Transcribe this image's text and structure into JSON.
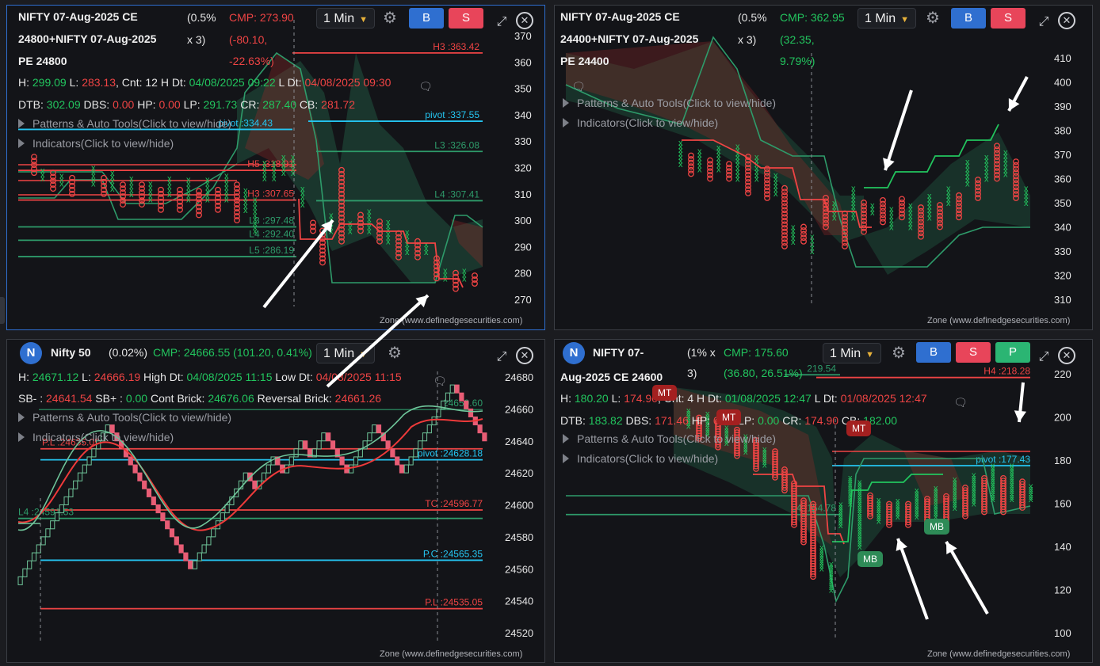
{
  "colors": {
    "green": "#22c55e",
    "red": "#ef4444",
    "cyan": "#25c4f0",
    "teal_line": "#2e9b6a",
    "bg": "#131418"
  },
  "p1": {
    "title_lines": [
      "NIFTY 07-Aug-2025 CE",
      "24800+NIFTY 07-Aug-2025",
      "PE 24800"
    ],
    "pct_lines": [
      "(0.5%",
      "x 3)"
    ],
    "cmp_lines": [
      "CMP: 273.90",
      "(-80.10,",
      "-22.63%)"
    ],
    "interval": "1 Min",
    "buy": "B",
    "sell": "S",
    "row_h": [
      [
        "H: ",
        "w"
      ],
      [
        "299.09",
        "g"
      ],
      [
        " L: ",
        "w"
      ],
      [
        "283.13",
        "r"
      ],
      [
        ", Cnt: 12 H Dt: ",
        "w"
      ],
      [
        "04/08/2025 09:22",
        "g"
      ],
      [
        " L Dt: ",
        "w"
      ],
      [
        "04/08/2025 09:30",
        "r"
      ]
    ],
    "row_d": [
      [
        "DTB: ",
        "w"
      ],
      [
        "302.09",
        "g"
      ],
      [
        " DBS: ",
        "w"
      ],
      [
        "0.00",
        "r"
      ],
      [
        " HP: ",
        "w"
      ],
      [
        "0.00",
        "r"
      ],
      [
        " LP: ",
        "w"
      ],
      [
        "291.73",
        "g"
      ],
      [
        " CR: ",
        "w"
      ],
      [
        "287.40",
        "g"
      ],
      [
        " CB: ",
        "w"
      ],
      [
        "281.72",
        "r"
      ]
    ],
    "patterns": "Patterns & Auto Tools(Click to view/hide)",
    "indicators": "Indicators(Click to view/hide)",
    "axis": [
      "370",
      "360",
      "350",
      "340",
      "330",
      "320",
      "310",
      "300",
      "290",
      "280",
      "270"
    ],
    "levels": [
      {
        "label": "H3 :363.42",
        "color": "#ef4444",
        "value": 363.42
      },
      {
        "label": "pivot :337.55",
        "color": "#25c4f0",
        "value": 337.55
      },
      {
        "label": "pivot :334.43",
        "color": "#25c4f0",
        "value": 334.43
      },
      {
        "label": "L3 :326.08",
        "color": "#2e9b6a",
        "value": 326.08
      },
      {
        "label": "H5 :318.91",
        "color": "#ef4444",
        "value": 318.91
      },
      {
        "label": "H3 :307.65",
        "color": "#ef4444",
        "value": 307.65
      },
      {
        "label": "L4 :307.41",
        "color": "#2e9b6a",
        "value": 307.41
      },
      {
        "label": "L3 :297.48",
        "color": "#2e9b6a",
        "value": 297.48
      },
      {
        "label": "L4 :292.40",
        "color": "#2e9b6a",
        "value": 292.4
      },
      {
        "label": "L5 :286.19",
        "color": "#2e9b6a",
        "value": 286.19
      }
    ],
    "zone": "Zone (www.definedgesecurities.com)"
  },
  "p2": {
    "title_lines": [
      "NIFTY 07-Aug-2025 CE",
      "24400+NIFTY 07-Aug-2025",
      "PE 24400"
    ],
    "pct_lines": [
      "(0.5%",
      "x 3)"
    ],
    "cmp_lines": [
      "CMP: 362.95",
      "(32.35,",
      "9.79%)"
    ],
    "interval": "1 Min",
    "buy": "B",
    "sell": "S",
    "patterns": "Patterns & Auto Tools(Click to view/hide)",
    "indicators": "Indicators(Click to view/hide)",
    "axis": [
      "410",
      "400",
      "390",
      "380",
      "370",
      "360",
      "350",
      "340",
      "330",
      "320",
      "310"
    ],
    "zone": "Zone (www.definedgesecurities.com)"
  },
  "p3": {
    "badge": "N",
    "title": "Nifty 50",
    "pct": "(0.02%)",
    "cmp": "CMP: 24666.55 (101.20, 0.41%)",
    "interval": "1 Min",
    "row_h": [
      [
        "H: ",
        "w"
      ],
      [
        "24671.12",
        "g"
      ],
      [
        " L: ",
        "w"
      ],
      [
        "24666.19",
        "r"
      ],
      [
        " High Dt: ",
        "w"
      ],
      [
        "04/08/2025 11:15",
        "g"
      ],
      [
        " Low Dt: ",
        "w"
      ],
      [
        "04/08/2025 11:15",
        "r"
      ]
    ],
    "row_s": [
      [
        "SB- : ",
        "w"
      ],
      [
        "24641.54",
        "r"
      ],
      [
        " SB+ : ",
        "w"
      ],
      [
        "0.00",
        "g"
      ],
      [
        " Cont Brick: ",
        "w"
      ],
      [
        "24676.06",
        "g"
      ],
      [
        " Reversal Brick: ",
        "w"
      ],
      [
        "24661.26",
        "r"
      ]
    ],
    "patterns": "Patterns & Auto Tools(Click to view/hide)",
    "indicators": "Indicators(Click to view/hide)",
    "axis": [
      "24680",
      "24660",
      "24640",
      "24620",
      "24600",
      "24580",
      "24560",
      "24540",
      "24520"
    ],
    "levels": [
      {
        "label": "24659.60",
        "color": "#2e9b6a",
        "value": 24659.6
      },
      {
        "label": "P.L :24635.05",
        "color": "#ef4444",
        "value": 24635.05
      },
      {
        "label": "pivot :24628.18",
        "color": "#25c4f0",
        "value": 24628.18
      },
      {
        "label": "TC :24596.77",
        "color": "#ef4444",
        "value": 24596.77
      },
      {
        "label": "L4 :24591.53",
        "color": "#2e9b6a",
        "value": 24591.53
      },
      {
        "label": "P.C :24565.35",
        "color": "#25c4f0",
        "value": 24565.35
      },
      {
        "label": "P.L :24535.05",
        "color": "#ef4444",
        "value": 24535.05
      }
    ],
    "zone": "Zone (www.definedgesecurities.com)"
  },
  "p4": {
    "badge": "N",
    "title_lines": [
      "NIFTY 07-",
      "Aug-2025 CE 24600"
    ],
    "pct_lines": [
      "(1% x",
      "3)"
    ],
    "cmp_lines": [
      "CMP: 175.60",
      "(36.80, 26.51%)"
    ],
    "interval": "1 Min",
    "buy": "B",
    "sell": "S",
    "p": "P",
    "row_h": [
      [
        "H: ",
        "w"
      ],
      [
        "180.20",
        "g"
      ],
      [
        " L: ",
        "w"
      ],
      [
        "174.90",
        "r"
      ],
      [
        ", Cnt: 4 H Dt: ",
        "w"
      ],
      [
        "01/08/2025 12:47",
        "g"
      ],
      [
        " L Dt: ",
        "w"
      ],
      [
        "01/08/2025 12:47",
        "r"
      ]
    ],
    "row_d": [
      [
        "DTB: ",
        "w"
      ],
      [
        "183.82",
        "g"
      ],
      [
        " DBS: ",
        "w"
      ],
      [
        "171.46",
        "r"
      ],
      [
        " HP: ",
        "w"
      ],
      [
        "0.00",
        "r"
      ],
      [
        " LP: ",
        "w"
      ],
      [
        "0.00",
        "g"
      ],
      [
        " CR: ",
        "w"
      ],
      [
        "174.90",
        "r"
      ],
      [
        " CB: ",
        "w"
      ],
      [
        "182.00",
        "g"
      ]
    ],
    "patterns": "Patterns & Auto Tools(Click to view/hide)",
    "indicators": "Indicators(Click to view/hide)",
    "axis": [
      "220",
      "200",
      "180",
      "160",
      "140",
      "120",
      "100"
    ],
    "levels": [
      {
        "label": "H4 :218.28",
        "color": "#ef4444",
        "value": 218.28
      },
      {
        "label": "219.54",
        "color": "#2e9b6a",
        "value": 219.54
      },
      {
        "label": "pivot :177.43",
        "color": "#25c4f0",
        "value": 177.43
      },
      {
        "label": "L4 :154.78",
        "color": "#2e9b6a",
        "value": 154.78
      }
    ],
    "markers": [
      "MT",
      "MT",
      "MB",
      "MB"
    ],
    "zone": "Zone (www.definedgesecurities.com)"
  }
}
